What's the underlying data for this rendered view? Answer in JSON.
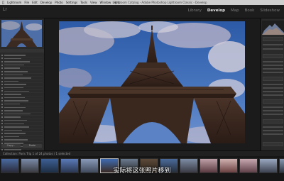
{
  "macos_menubar": {
    "app_name": "Lightroom",
    "menus": [
      "File",
      "Edit",
      "Develop",
      "Photo",
      "Settings",
      "Tools",
      "View",
      "Window",
      "Help"
    ],
    "window_title": "Lightroom Catalog - Adobe Photoshop Lightroom Classic - Develop"
  },
  "modules": {
    "items": [
      "Library",
      "Develop",
      "Map",
      "Book",
      "Slideshow"
    ],
    "active": "Develop"
  },
  "left_panel": {
    "panel_label": "Presets",
    "buttons": [
      "Copy...",
      "Paste"
    ]
  },
  "filmstrip_bar": {
    "text": "Collection: Paris Trip     1 of 24 photos / 1 selected"
  },
  "subtitle": "实际将这张照片移到",
  "colors": {
    "active_module": "#e8e8e8",
    "panel_bg": "#2a2a2a",
    "sky_blue": "#3e6ab0"
  }
}
